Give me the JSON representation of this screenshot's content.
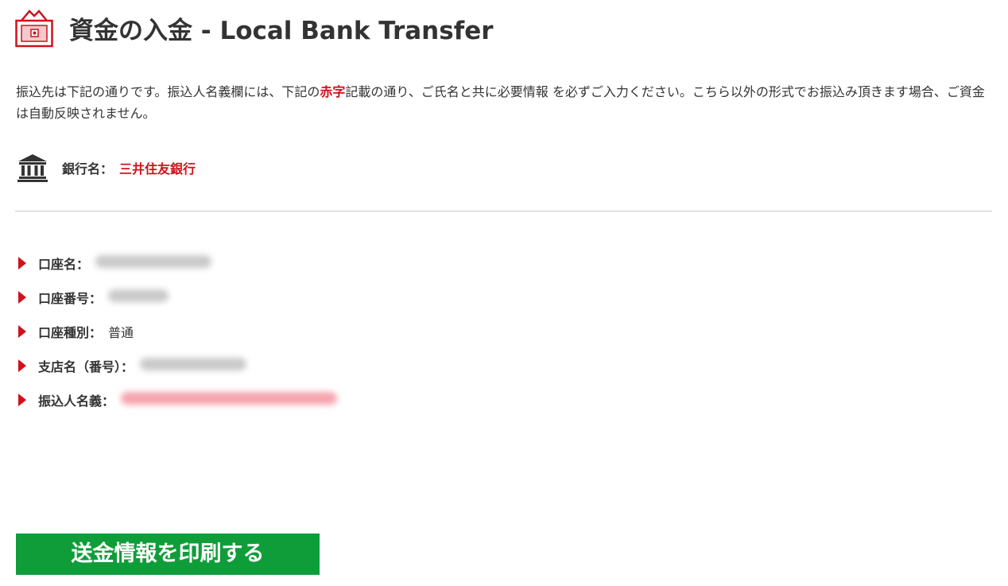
{
  "header": {
    "icon": "cash-register-icon",
    "title": "資金の入金 - Local Bank Transfer"
  },
  "intro": {
    "part1": "振込先は下記の通りです。振込人名義欄には、下記の",
    "highlight": "赤字",
    "part2": "記載の通り、ご氏名と共に必要情報 を必ずご入力ください。こちら以外の形式でお振込み頂きます場合、ご資金は自動反映されません。"
  },
  "bank": {
    "icon": "bank-icon",
    "label": "銀行名：",
    "value": "三井住友銀行"
  },
  "details": {
    "account_name": {
      "label": "口座名："
    },
    "account_number": {
      "label": "口座番号："
    },
    "account_type": {
      "label": "口座種別：",
      "value": "普通"
    },
    "branch": {
      "label": "支店名（番号）："
    },
    "transfer_name": {
      "label": "振込人名義："
    }
  },
  "actions": {
    "print_label": "送金情報を印刷する"
  },
  "colors": {
    "accent_red": "#d0121b",
    "button_green": "#0f9d3a",
    "text": "#333333",
    "divider": "#cccccc"
  }
}
